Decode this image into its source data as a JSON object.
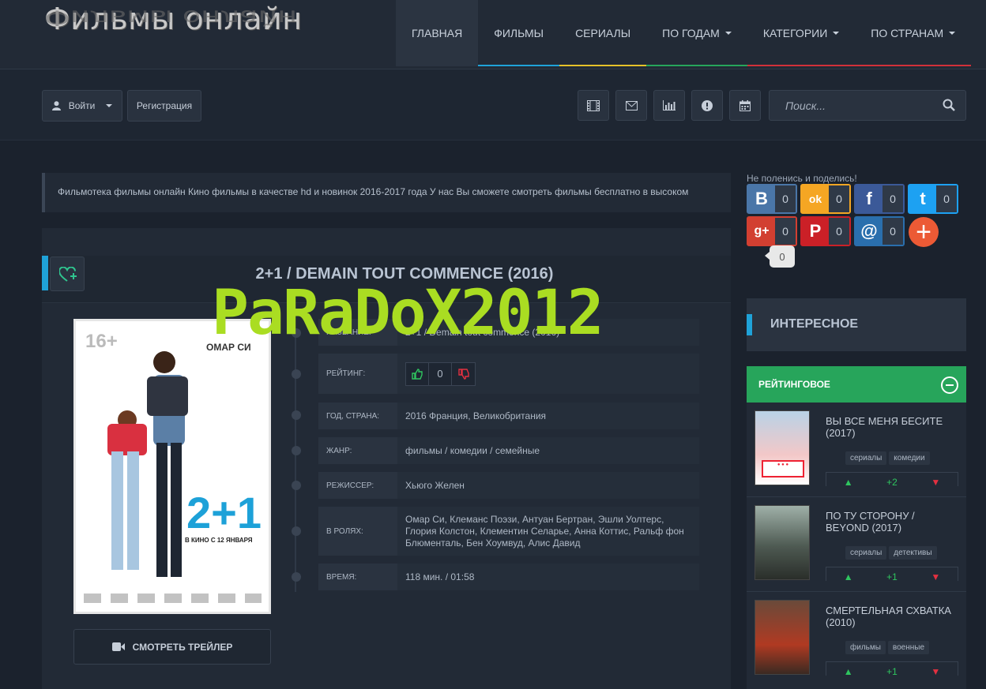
{
  "header": {
    "logo_text": "Фильмы онлайн",
    "nav": [
      {
        "label": "Главная",
        "color": "#2b3441"
      },
      {
        "label": "Фильмы",
        "color": "#1fa2d8"
      },
      {
        "label": "Сериалы",
        "color": "#e6c229"
      },
      {
        "label": "По годам",
        "color": "#27a55b"
      },
      {
        "label": "Категории",
        "color": "#d2303a"
      },
      {
        "label": "По странам",
        "color": "#d2303a"
      }
    ]
  },
  "toolbar": {
    "login_label": "Войти",
    "register_label": "Регистрация",
    "search_placeholder": "Поиск..."
  },
  "description": "Фильмотека фильмы онлайн Кино фильмы в качестве hd и новинок 2016-2017 года У нас Вы сможете смотреть фильмы бесплатно в высоком",
  "movie": {
    "title": "2+1 / DEMAIN TOUT COMMENCE (2016)",
    "watermark": "PaRaDoX2012",
    "poster": {
      "age": "16+",
      "actor": "ОМАР СИ",
      "big": "2+1",
      "release": "В КИНО С 12 ЯНВАРЯ"
    },
    "trailer_label": "СМОТРЕТЬ ТРЕЙЛЕР",
    "rows": {
      "title_label": "НАЗВАНИЕ:",
      "title_value": "2+1 / Demain tout commence (2016)",
      "rating_label": "Рейтинг:",
      "rating_value": "0",
      "year_label": "Год, страна:",
      "year_value": "2016 Франция, Великобритания",
      "genre_label": "Жанр:",
      "genre_value": "фильмы / комедии / семейные",
      "director_label": "Режиссер:",
      "director_value": "Хьюго Желен",
      "cast_label": "В ролях:",
      "cast_value": "Омар Си, Клеманс Поэзи, Антуан Бертран, Эшли Уолтерс, Глория Колстон, Клементин Селарье, Анна Коттис, Ральф фон Блюменталь, Бен Хоумвуд, Алис Давид",
      "time_label": "Время:",
      "time_value": "118 мин. / 01:58"
    }
  },
  "share": {
    "label": "Не поленись и поделись!",
    "bubble": "0",
    "buttons": [
      {
        "icon": "B",
        "count": "0",
        "color": "#4a76a8"
      },
      {
        "icon": "ok",
        "count": "0",
        "color": "#f5a623"
      },
      {
        "icon": "f",
        "count": "0",
        "color": "#3b5998"
      },
      {
        "icon": "t",
        "count": "0",
        "color": "#1da1f2"
      },
      {
        "icon": "g+",
        "count": "0",
        "color": "#d23f31"
      },
      {
        "icon": "P",
        "count": "0",
        "color": "#cb2027"
      },
      {
        "icon": "@",
        "count": "0",
        "color": "#2a6fad"
      }
    ]
  },
  "sidebar": {
    "interesting": "ИНТЕРЕСНОЕ",
    "rated": "РЕЙТИНГОВОЕ",
    "items": [
      {
        "title": "ВЫ ВСЕ МЕНЯ БЕСИТЕ (2017)",
        "tags": [
          "сериалы",
          "комедии"
        ],
        "score": "+2"
      },
      {
        "title": "ПО ТУ СТОРОНУ / BEYOND (2017)",
        "tags": [
          "сериалы",
          "детективы"
        ],
        "score": "+1"
      },
      {
        "title": "СМЕРТЕЛЬНАЯ СХВАТКА (2010)",
        "tags": [
          "фильмы",
          "военные"
        ],
        "score": "+1"
      }
    ]
  }
}
